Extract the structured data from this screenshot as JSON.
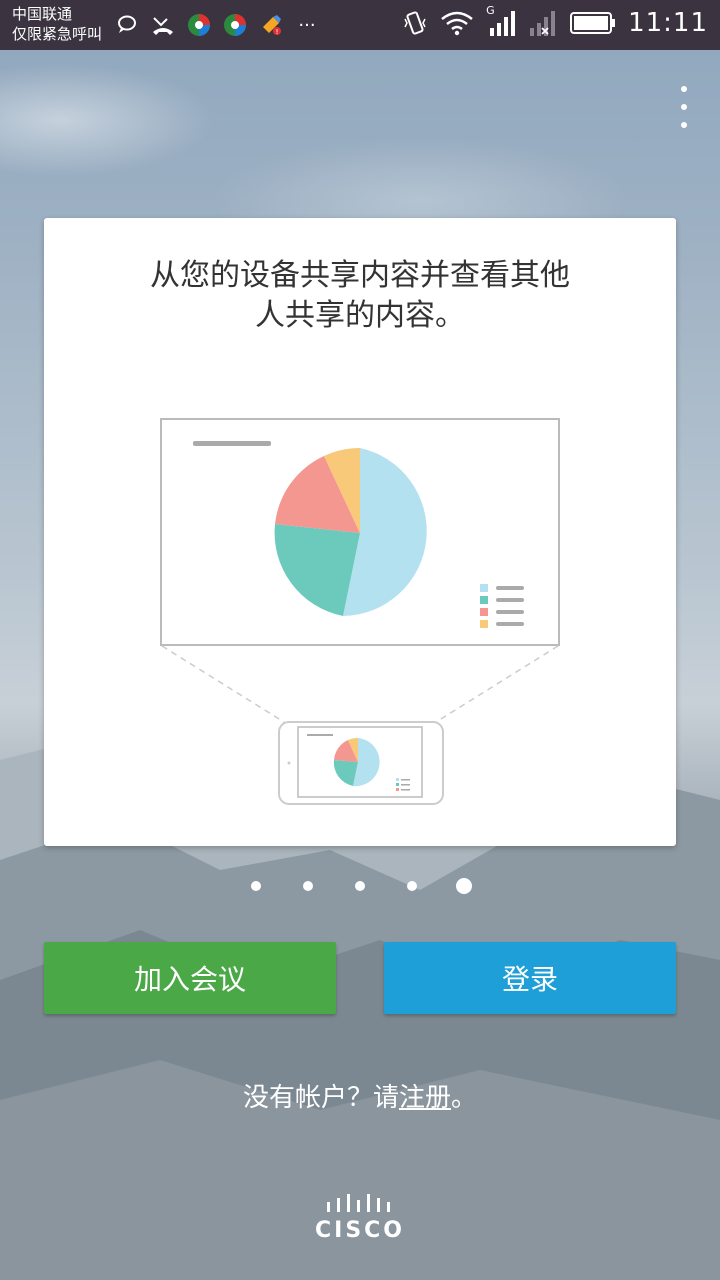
{
  "status_bar": {
    "carrier_line1": "中国联通",
    "carrier_line2": "仅限紧急呼叫",
    "more_icons": "···",
    "network_label": "G",
    "time": "11:11"
  },
  "card": {
    "text_line1": "从您的设备共享内容并查看其他",
    "text_line2": "人共享的内容。"
  },
  "pager": {
    "count": 5,
    "active_index": 4
  },
  "buttons": {
    "join_meeting": "加入会议",
    "login": "登录"
  },
  "signup": {
    "prefix": "没有帐户？请",
    "link": "注册",
    "suffix": "。"
  },
  "brand": {
    "logo_text": "CISCO"
  },
  "colors": {
    "status_bar": "#3b3340",
    "join_button": "#4aa846",
    "login_button": "#1e9fd8",
    "pie_blue": "#b3e1ef",
    "pie_teal": "#6ccabd",
    "pie_red": "#f49790",
    "pie_yellow": "#f8c978"
  },
  "icons": [
    "chat-bubble-icon",
    "missed-call-icon",
    "app-icon",
    "app-icon",
    "paint-icon",
    "vibrate-icon",
    "wifi-icon",
    "signal-icon",
    "battery-icon",
    "overflow-menu-icon",
    "cisco-logo"
  ]
}
